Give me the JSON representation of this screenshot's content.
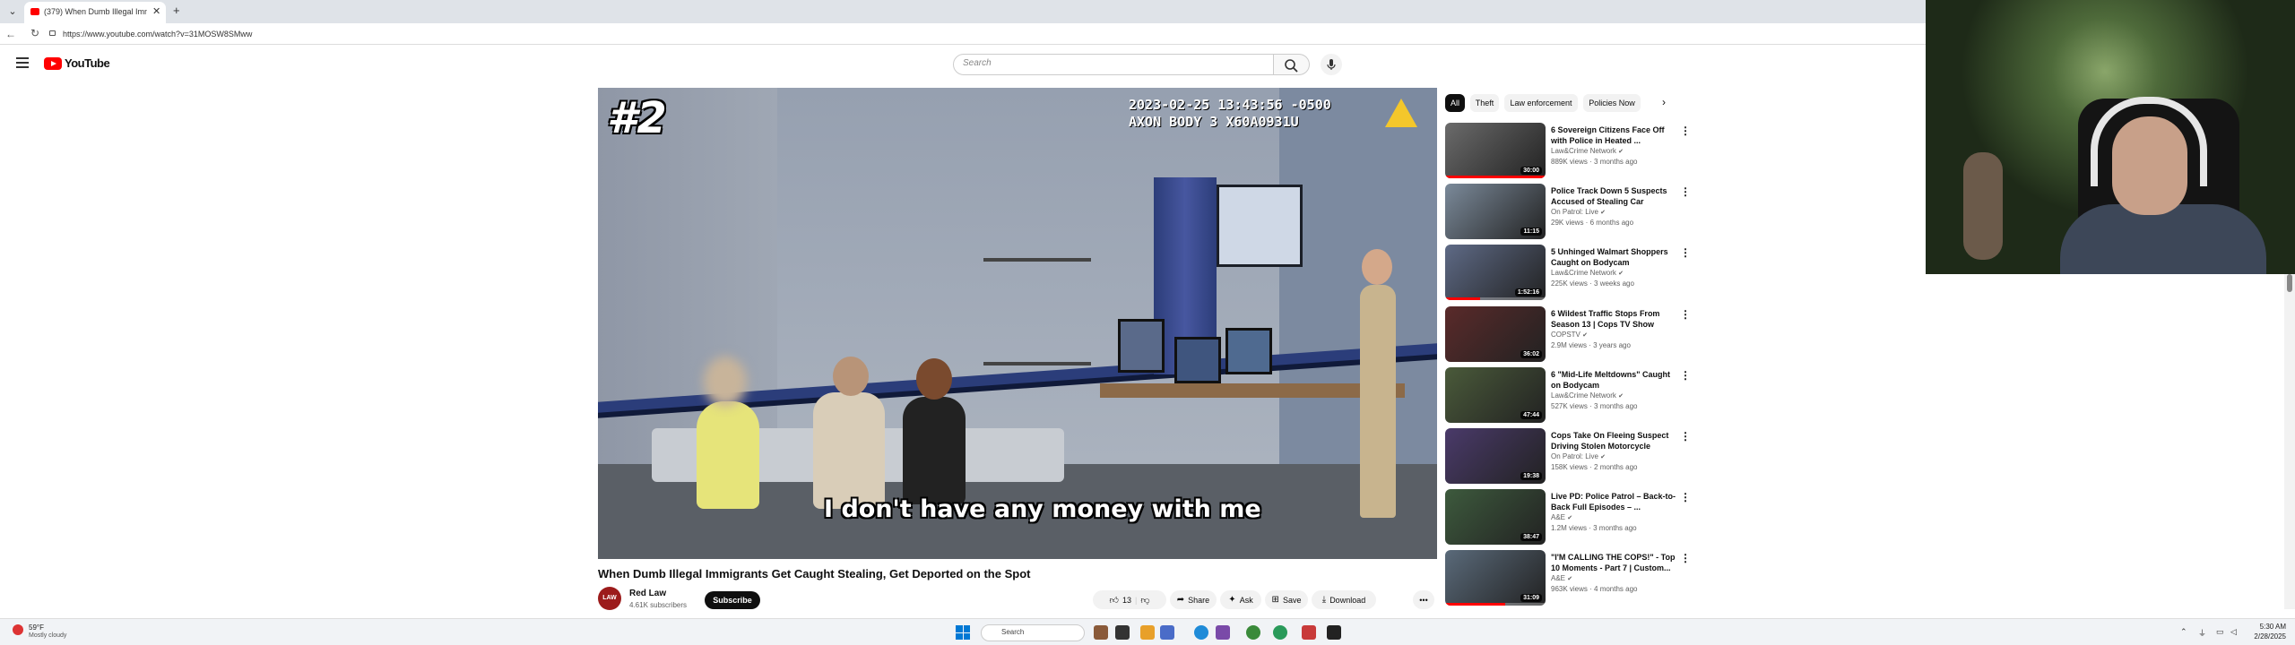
{
  "browser": {
    "tab_title": "(379) When Dumb Illegal Imm",
    "url": "https://www.youtube.com/watch?v=31MOSW8SMww",
    "tab_close": "✕",
    "new_tab": "+"
  },
  "youtube": {
    "logo_text": "YouTube",
    "search_placeholder": "Search"
  },
  "player": {
    "rank_overlay": "#2",
    "timestamp_line1": "2023-02-25 13:43:56 -0500",
    "timestamp_line2": "AXON BODY 3 X60A0931U",
    "caption": "I don't have any money with me"
  },
  "video": {
    "title": "When Dumb Illegal Immigrants Get Caught Stealing, Get Deported on the Spot",
    "channel_avatar_text": "LAW",
    "channel_name": "Red Law",
    "subscribers": "4.61K subscribers",
    "subscribe_label": "Subscribe",
    "like_count": "13",
    "share_label": "Share",
    "ask_label": "Ask",
    "save_label": "Save",
    "download_label": "Download"
  },
  "sidebar": {
    "chips": [
      "All",
      "Theft",
      "Law enforcement",
      "Policies Now"
    ],
    "recommendations": [
      {
        "title": "6 Sovereign Citizens Face Off with Police in Heated ...",
        "channel": "Law&Crime Network",
        "meta": "889K views · 3 months ago",
        "duration": "30:00",
        "progress": 1.0,
        "thumb_color": "#6b6b6b"
      },
      {
        "title": "Police Track Down 5 Suspects Accused of Stealing Car",
        "channel": "On Patrol: Live",
        "meta": "29K views · 6 months ago",
        "duration": "11:15",
        "progress": 0,
        "thumb_color": "#7b8a9a"
      },
      {
        "title": "5 Unhinged Walmart Shoppers Caught on Bodycam",
        "channel": "Law&Crime Network",
        "meta": "225K views · 3 weeks ago",
        "duration": "1:52:16",
        "progress": 0.35,
        "thumb_color": "#5e6a86"
      },
      {
        "title": "6 Wildest Traffic Stops From Season 13 | Cops TV Show",
        "channel": "COPSTV",
        "meta": "2.9M views · 3 years ago",
        "duration": "36:02",
        "progress": 0,
        "thumb_color": "#5a2a2a"
      },
      {
        "title": "6 \"Mid-Life Meltdowns\" Caught on Bodycam",
        "channel": "Law&Crime Network",
        "meta": "527K views · 3 months ago",
        "duration": "47:44",
        "progress": 0,
        "thumb_color": "#4a5a3a"
      },
      {
        "title": "Cops Take On Fleeing Suspect Driving Stolen Motorcycle",
        "channel": "On Patrol: Live",
        "meta": "158K views · 2 months ago",
        "duration": "19:38",
        "progress": 0,
        "thumb_color": "#4a3a6a"
      },
      {
        "title": "Live PD: Police Patrol – Back-to-Back Full Episodes – ...",
        "channel": "A&E",
        "meta": "1.2M views · 3 months ago",
        "duration": "38:47",
        "progress": 0,
        "thumb_color": "#3d5a3d"
      },
      {
        "title": "\"I'M CALLING THE COPS!\" - Top 10 Moments - Part 7 | Custom...",
        "channel": "A&E",
        "meta": "963K views · 4 months ago",
        "duration": "31:09",
        "progress": 0.6,
        "thumb_color": "#5a6a7a"
      }
    ]
  },
  "taskbar": {
    "weather_temp": "59°F",
    "weather_desc": "Mostly cloudy",
    "search_label": "Search",
    "time": "5:30 AM",
    "date": "2/28/2025"
  }
}
